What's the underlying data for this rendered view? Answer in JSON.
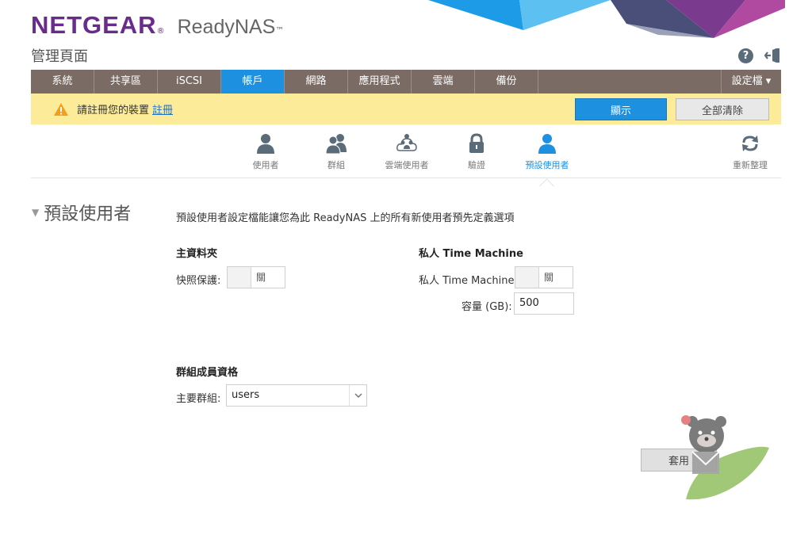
{
  "header": {
    "brand": "NETGEAR",
    "brand_mark": "®",
    "product": "ReadyNAS",
    "product_mark": "™",
    "page_title": "管理頁面",
    "help_icon": "question-circle-icon",
    "logout_icon": "logout-icon"
  },
  "tabs": [
    {
      "label": "系統"
    },
    {
      "label": "共享區"
    },
    {
      "label": "iSCSI"
    },
    {
      "label": "帳戶",
      "active": true
    },
    {
      "label": "網路"
    },
    {
      "label": "應用程式"
    },
    {
      "label": "雲端"
    },
    {
      "label": "備份"
    }
  ],
  "settings_menu": "設定檔 ▾",
  "notice": {
    "text": "請註冊您的裝置",
    "link": "註冊",
    "show_button": "顯示",
    "clear_button": "全部清除",
    "icon": "warning-triangle-icon"
  },
  "subnav": {
    "items": [
      {
        "label": "使用者",
        "icon": "user-icon"
      },
      {
        "label": "群組",
        "icon": "group-icon"
      },
      {
        "label": "雲端使用者",
        "icon": "cloud-users-icon"
      },
      {
        "label": "驗證",
        "icon": "lock-icon"
      },
      {
        "label": "預設使用者",
        "icon": "default-user-icon",
        "active": true
      }
    ],
    "refresh": {
      "label": "重新整理",
      "icon": "refresh-icon"
    }
  },
  "section": {
    "title": "預設使用者",
    "description": "預設使用者設定檔能讓您為此 ReadyNAS 上的所有新使用者預先定義選項",
    "home_folder": {
      "heading": "主資料夾",
      "snapshot_label": "快照保護:",
      "snapshot_state": "關"
    },
    "time_machine": {
      "heading": "私人 Time Machine",
      "toggle_label": "私人 Time Machine:",
      "toggle_state": "關",
      "capacity_label": "容量 (GB):",
      "capacity_value": "500"
    },
    "group_membership": {
      "heading": "群組成員資格",
      "primary_label": "主要群組:",
      "primary_value": "users"
    },
    "apply_button": "套用"
  },
  "colors": {
    "brand_purple": "#6a2c8c",
    "tab_bar": "#7a6b64",
    "accent_blue": "#1e90e0",
    "notice_yellow": "#fcec9a"
  }
}
